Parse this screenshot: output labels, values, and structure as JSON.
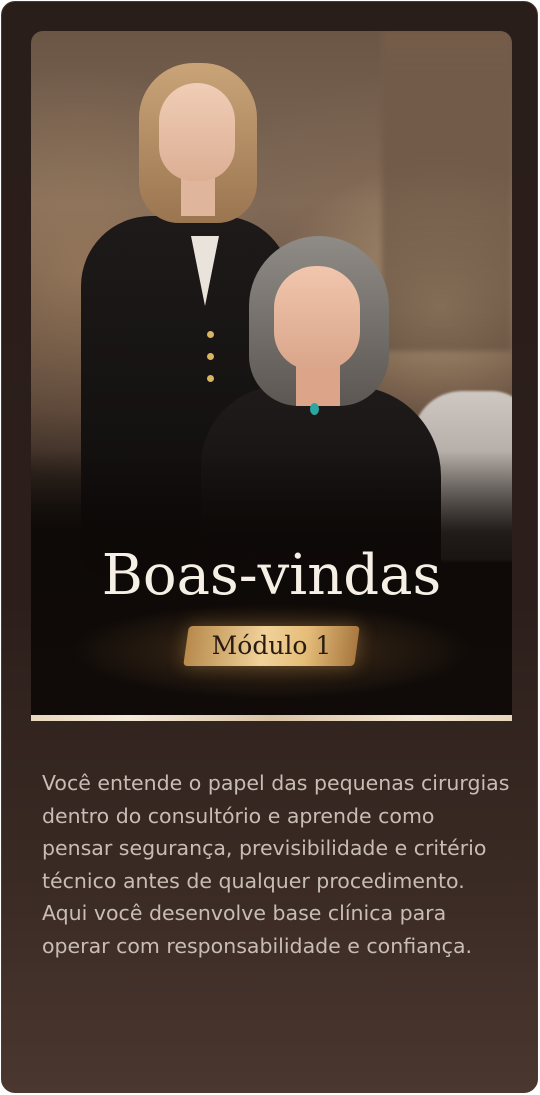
{
  "module_card": {
    "hero": {
      "title": "Boas-vindas",
      "badge": "Módulo 1"
    },
    "description": "Você entende o papel das pequenas cirurgias dentro do consultório e aprende como pensar segurança, previsibilidade e critério técnico antes de qualquer procedimento. Aqui você desenvolve base clínica para operar com responsabilidade e confiança.",
    "colors": {
      "card_background": "#2c1f1b",
      "accent_gold": "#e5bd79",
      "title_text": "#f6efe6",
      "body_text": "#c8bdb6"
    }
  }
}
